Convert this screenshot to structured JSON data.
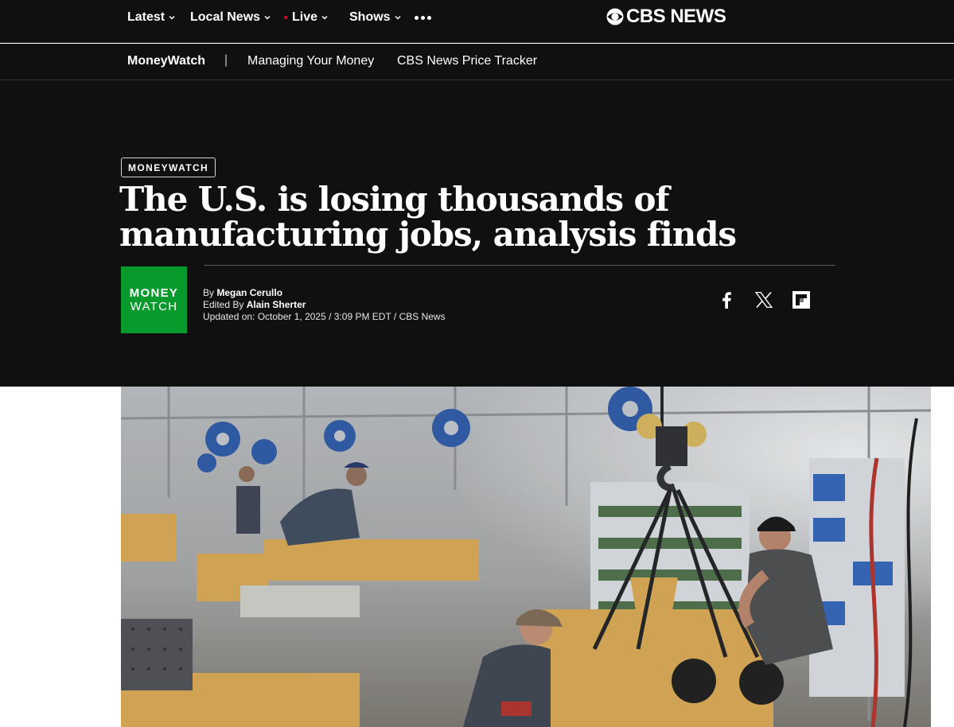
{
  "nav": {
    "items": [
      {
        "label": "Latest"
      },
      {
        "label": "Local News"
      },
      {
        "label": "Live"
      },
      {
        "label": "Shows"
      }
    ],
    "logo_text": "CBS NEWS"
  },
  "subnav": {
    "brand": "MoneyWatch",
    "separator": "|",
    "links": [
      "Managing Your Money",
      "CBS News Price Tracker"
    ]
  },
  "article": {
    "kicker": "MONEYWATCH",
    "headline_line1": "The U.S. is losing thousands of",
    "headline_line2": "manufacturing jobs, analysis finds",
    "badge_line1": "MONEY",
    "badge_line2": "WATCH",
    "by_prefix": "By",
    "author": "Megan Cerullo",
    "edited_prefix": "Edited By",
    "editor": "Alain Sherter",
    "updated": "Updated on: October 1, 2025 / 3:09 PM EDT / CBS News"
  },
  "icons": [
    "chevron-down-icon",
    "live-dot-icon",
    "more-icon",
    "cbs-eye-icon",
    "facebook-icon",
    "x-icon",
    "flipboard-icon"
  ],
  "colors": {
    "header_bg": "#101010",
    "live_red": "#e4002b",
    "moneywatch_green": "#089a2d"
  }
}
